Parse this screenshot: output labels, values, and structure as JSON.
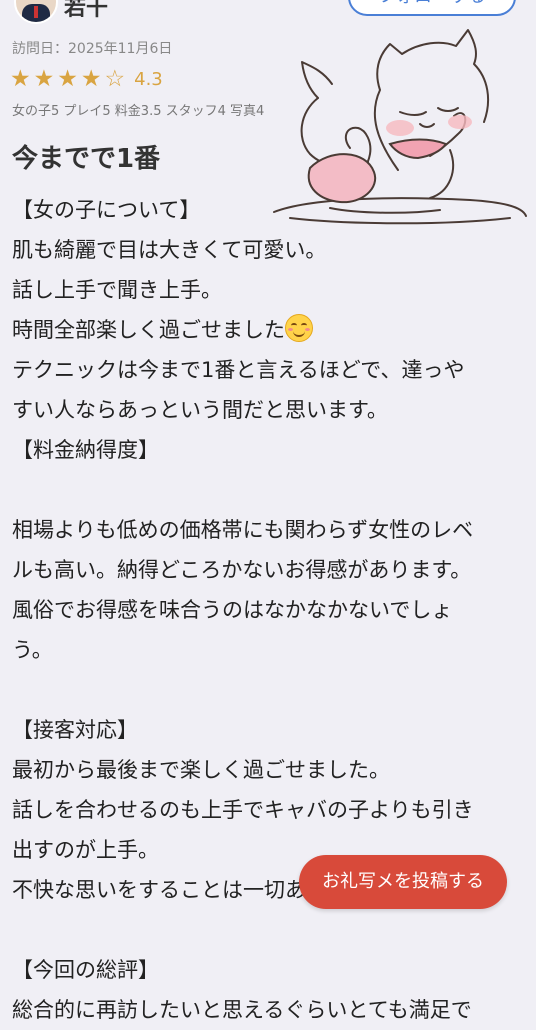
{
  "header": {
    "username": "若干",
    "follow_label": "フォローする"
  },
  "review": {
    "visit_date": "訪問日：2025年11月6日",
    "score": "4.3",
    "stars_filled": 4,
    "stars_total": 5,
    "breakdown": "女の子5 プレイ5 料金3.5 スタッフ4 写真4",
    "title": "今までで1番",
    "lines": [
      "【女の子について】",
      "肌も綺麗で目は大きくて可愛い。",
      "話し上手で聞き上手。",
      "時間全部楽しく過ごせました",
      "テクニックは今まで1番と言えるほどで、達っや",
      "すい人ならあっという間だと思います。",
      "【料金納得度】",
      "",
      "相場よりも低めの価格帯にも関わらず女性のレベ",
      "ルも高い。納得どころかないお得感があります。",
      "風俗でお得感を味合うのはなかなかないでしょ",
      "う。",
      "",
      "【接客対応】",
      "最初から最後まで楽しく過ごせました。",
      "話しを合わせるのも上手でキャバの子よりも引き",
      "出すのが上手。",
      "不快な思いをすることは一切ありませんでした。",
      "",
      "【今回の総評】",
      "総合的に再訪したいと思えるぐらいとても満足で"
    ]
  },
  "actions": {
    "post_photo_label": "お礼写メを投稿する"
  },
  "colors": {
    "background": "#f0eff5",
    "star": "#d9a441",
    "accent_blue": "#4a7fd6",
    "post_button": "#d84a3a"
  },
  "icons": {
    "emoji": "smiling-face-icon",
    "mascot": "cat-mascot-illustration"
  }
}
